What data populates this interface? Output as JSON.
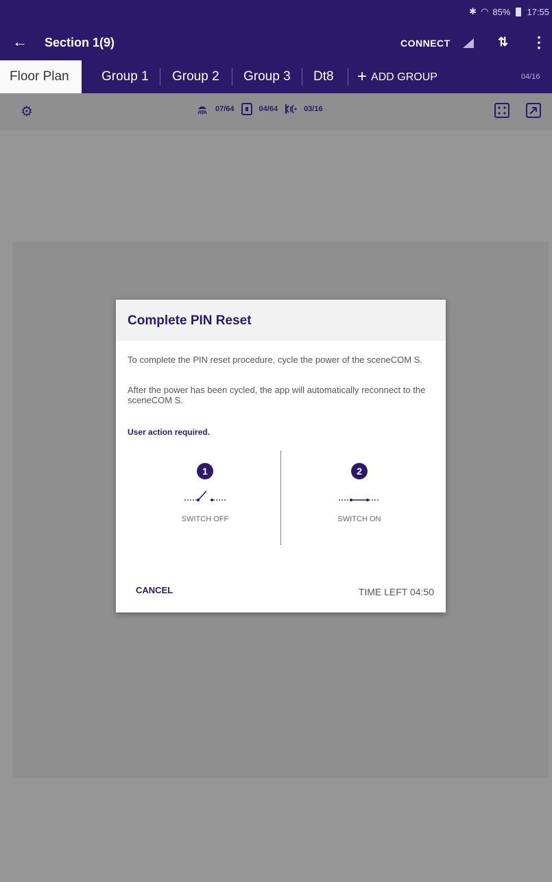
{
  "status_bar": {
    "bluetooth_icon": "bluetooth-icon",
    "wifi_icon": "wifi-icon",
    "battery": "85%",
    "time": "17:55"
  },
  "action_bar": {
    "title": "Section 1(9)",
    "connect_label": "CONNECT"
  },
  "tabs": {
    "items": [
      "Floor Plan",
      "Group 1",
      "Group 2",
      "Group 3",
      "Dt8"
    ],
    "add_group": "ADD GROUP",
    "count": "04/16"
  },
  "toolbar": {
    "lamps": "07/64",
    "modules": "04/64",
    "sensors": "03/16"
  },
  "dialog": {
    "title": "Complete PIN Reset",
    "p1": "To complete the PIN reset procedure, cycle the power of the sceneCOM S.",
    "p2": "After the power has been cycled, the app will automatically reconnect to the sceneCOM S.",
    "user_action": "User action required.",
    "step1": {
      "num": "1",
      "label": "SWITCH OFF"
    },
    "step2": {
      "num": "2",
      "label": "SWITCH ON"
    },
    "cancel": "CANCEL",
    "time_left": "TIME LEFT 04:50"
  },
  "colors": {
    "primary": "#2b1a6a",
    "overlay": "#969696"
  }
}
